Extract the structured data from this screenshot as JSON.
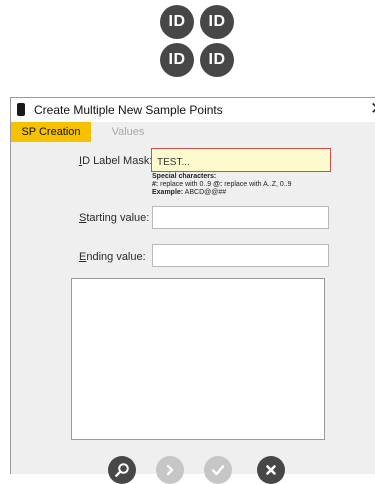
{
  "logo": {
    "badges": [
      "ID",
      "ID",
      "ID",
      "ID"
    ]
  },
  "dialog": {
    "title": "Create Multiple New Sample Points",
    "close_glyph": "✕",
    "tabs": [
      {
        "label": "SP Creation",
        "active": true
      },
      {
        "label": "Values",
        "active": false
      }
    ],
    "id_label_mask": {
      "label_accel": "I",
      "label_rest": "D Label Mask:",
      "value": "TEST..."
    },
    "hint": {
      "heading": "Special characters:",
      "line1_key": "#:",
      "line1_text": " replace with 0..9 ",
      "line1_key2": "@:",
      "line1_text2": " replace with A..Z, 0..9",
      "example_key": "Example:",
      "example_text": " ABCD@@##"
    },
    "starting_value": {
      "label_accel": "S",
      "label_rest": "tarting value:",
      "value": ""
    },
    "ending_value": {
      "label_accel": "E",
      "label_rest": "nding value:",
      "value": ""
    },
    "toolbar": [
      {
        "name": "preview-button",
        "icon": "magnifier-icon",
        "enabled": true
      },
      {
        "name": "next-button",
        "icon": "chevron-right-icon",
        "enabled": false
      },
      {
        "name": "confirm-button",
        "icon": "checkmark-icon",
        "enabled": false
      },
      {
        "name": "cancel-button",
        "icon": "close-icon",
        "enabled": true
      }
    ],
    "colors": {
      "accent": "#f6c200",
      "mask_field_bg": "#fdfbcd",
      "mask_field_border": "#d34a4a",
      "button_dark": "#474747",
      "button_disabled": "#c6c6c6"
    }
  }
}
